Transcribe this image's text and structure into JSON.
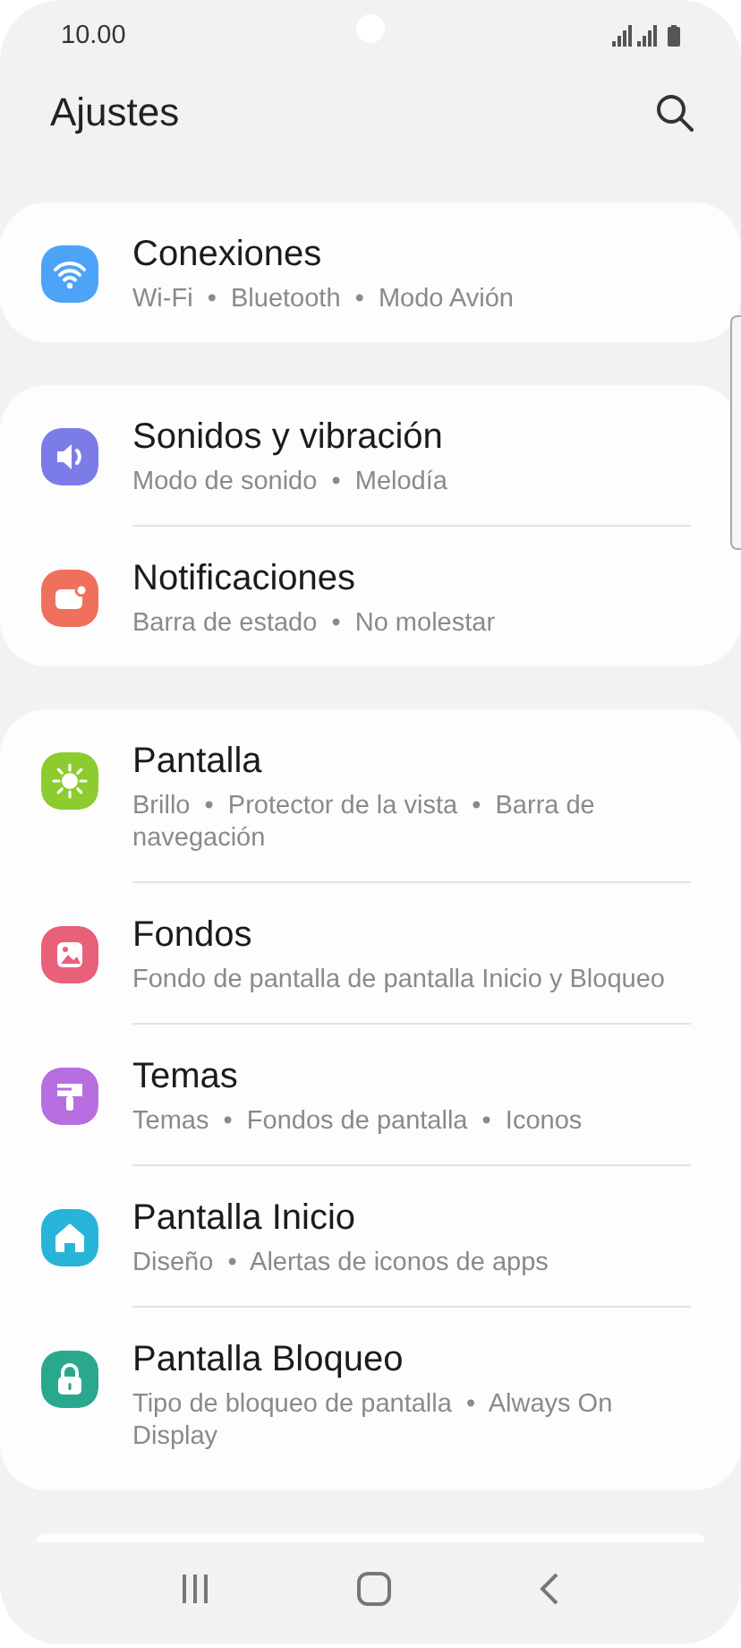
{
  "status_bar": {
    "time": "10.00"
  },
  "header": {
    "title": "Ajustes"
  },
  "groups": [
    {
      "items": [
        {
          "kind": "wifi",
          "color": "#4da3f8",
          "title": "Conexiones",
          "subtitle": "Wi-Fi  •  Bluetooth  •  Modo Avión"
        }
      ]
    },
    {
      "items": [
        {
          "kind": "sound",
          "color": "#7b7ce8",
          "title": "Sonidos y vibración",
          "subtitle": "Modo de sonido  •  Melodía"
        },
        {
          "kind": "notification",
          "color": "#f0705e",
          "title": "Notificaciones",
          "subtitle": "Barra de estado  •  No molestar"
        }
      ]
    },
    {
      "items": [
        {
          "kind": "display",
          "color": "#8ccc2e",
          "title": "Pantalla",
          "subtitle": "Brillo  •  Protector de la vista  •  Barra de navegación"
        },
        {
          "kind": "wallpaper",
          "color": "#e8607a",
          "title": "Fondos",
          "subtitle": "Fondo de pantalla de pantalla Inicio y Bloqueo"
        },
        {
          "kind": "themes",
          "color": "#b66ee0",
          "title": "Temas",
          "subtitle": "Temas  •  Fondos de pantalla  •  Iconos"
        },
        {
          "kind": "home",
          "color": "#27b4d8",
          "title": "Pantalla Inicio",
          "subtitle": "Diseño  •  Alertas de iconos de apps"
        },
        {
          "kind": "lock",
          "color": "#2aa88e",
          "title": "Pantalla Bloqueo",
          "subtitle": "Tipo de bloqueo de pantalla  •  Always On Display"
        }
      ]
    }
  ]
}
